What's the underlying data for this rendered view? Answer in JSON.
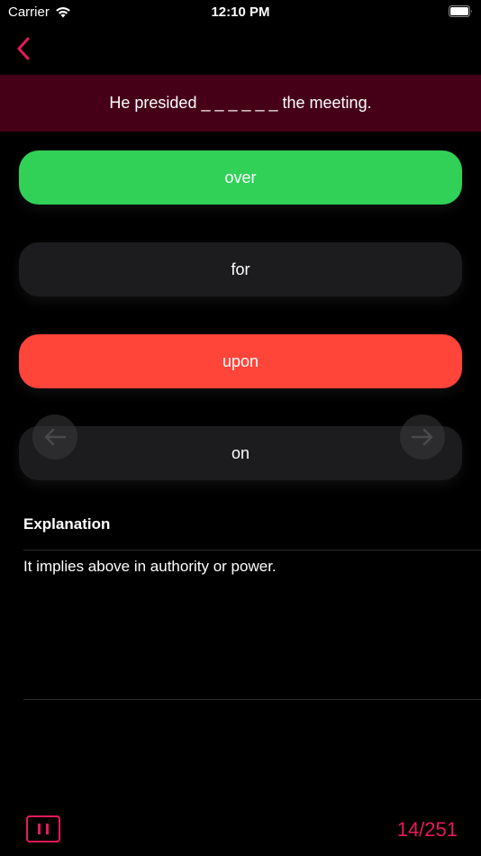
{
  "status_bar": {
    "carrier": "Carrier",
    "time": "12:10 PM"
  },
  "header": {
    "back_icon": "chevron-left-icon"
  },
  "question": {
    "text": "He presided _ _ _ _ _ _ the meeting."
  },
  "options": [
    {
      "label": "over",
      "state": "correct",
      "color": "#31d158"
    },
    {
      "label": "for",
      "state": "neutral",
      "color": "#1c1c1e"
    },
    {
      "label": "upon",
      "state": "wrong",
      "color": "#ff443a"
    },
    {
      "label": "on",
      "state": "neutral",
      "color": "#1c1c1e"
    }
  ],
  "navigation": {
    "prev_icon": "arrow-left-icon",
    "next_icon": "arrow-right-icon"
  },
  "explanation": {
    "title": "Explanation",
    "text": "It implies above in authority or power."
  },
  "footer": {
    "pause_icon": "pause-icon",
    "counter": "14/251"
  },
  "colors": {
    "accent": "#e8195a",
    "question_bg": "#450018",
    "background": "#000000"
  }
}
